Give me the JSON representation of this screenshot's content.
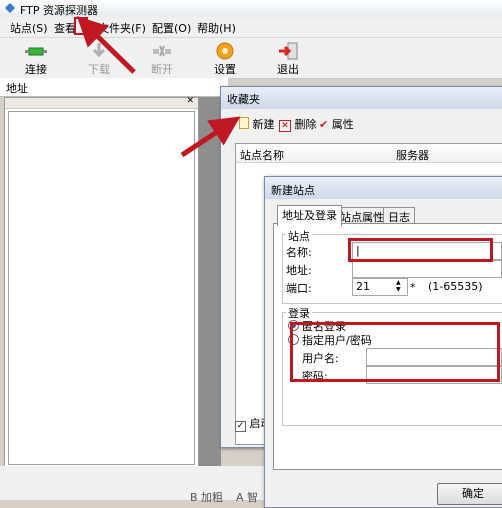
{
  "window": {
    "title": "FTP 资源探测器"
  },
  "menu": [
    "站点(S)",
    "查看",
    "文件夹(F)",
    "配置(O)",
    "帮助(H)"
  ],
  "toolbar": {
    "connect": "连接",
    "download": "下载",
    "disconnect": "断开",
    "settings": "设置",
    "exit": "退出"
  },
  "address_label": "地址",
  "favorites": {
    "title": "收藏夹",
    "new_label": "新建",
    "delete_label": "删除",
    "props_label": "属性",
    "col_name": "站点名称",
    "col_server": "服务器",
    "startup_label": "启动"
  },
  "new_site": {
    "title": "新建站点",
    "tabs": [
      "地址及登录",
      "站点属性",
      "日志"
    ],
    "site_group": "站点",
    "name_label": "名称:",
    "name_value": "|",
    "address_label": "地址:",
    "port_label": "端口:",
    "port_value": "21",
    "port_required": "*",
    "port_range": "(1-65535)",
    "login_group": "登录",
    "anonymous_label": "匿名登录",
    "specify_label": "指定用户/密码",
    "username_label": "用户名:",
    "password_label": "密码:",
    "ok_label": "确定"
  },
  "status_fragments": {
    "bold": "B 加粗",
    "a": "A 智"
  },
  "colors": {
    "annotation_red": "#c01822",
    "titlebar_blue": "#cfd9ea"
  },
  "icons": {
    "connect": "connect-plug-icon",
    "download": "download-arrow-icon",
    "disconnect": "disconnect-icon",
    "settings": "gear-settings-icon",
    "exit": "exit-door-icon"
  }
}
